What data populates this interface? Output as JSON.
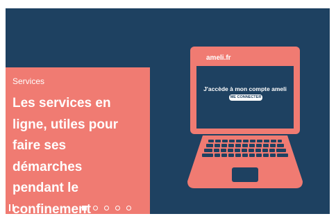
{
  "slide": {
    "label": "Services",
    "headline_lines": [
      "Les services en",
      "ligne, utiles pour",
      "faire ses",
      "démarches",
      "pendant le",
      "confinement"
    ]
  },
  "laptop": {
    "brand": "ameli.fr",
    "cta_text": "J'accède à mon compte ameli",
    "cta_button": "ME CONNECTER"
  },
  "carousel": {
    "total_slides": 5,
    "active_slide": 1,
    "pause_icon": "pause-icon"
  },
  "colors": {
    "background": "#1e4161",
    "accent": "#f07b72",
    "text": "#ffffff"
  }
}
